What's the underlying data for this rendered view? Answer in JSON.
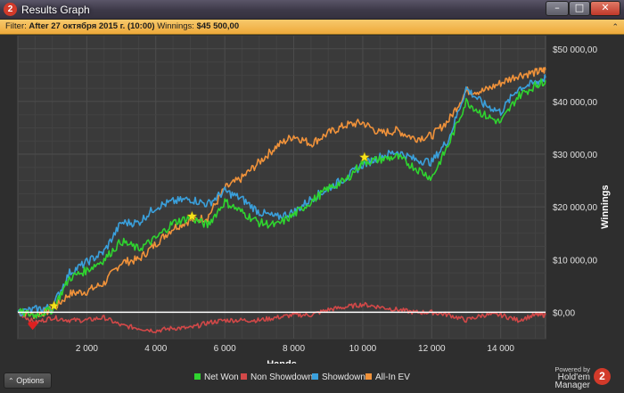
{
  "window": {
    "title": "Results Graph",
    "app_icon_glyph": "2",
    "minimize_glyph": "–",
    "maximize_glyph": "□",
    "close_glyph": "✕"
  },
  "filter": {
    "prefix": "Filter:",
    "text": "After 27 октября 2015 г. (10:00)",
    "winnings_label": "Winnings:",
    "winnings_value": "$45 500,00"
  },
  "chart_data": {
    "type": "line",
    "xlabel": "Hands",
    "ylabel": "Winnings",
    "xlim": [
      0,
      15300
    ],
    "ylim": [
      -5000,
      52500
    ],
    "x_ticks": [
      2000,
      4000,
      6000,
      8000,
      10000,
      12000,
      14000
    ],
    "x_tick_labels": [
      "2 000",
      "4 000",
      "6 000",
      "8 000",
      "10 000",
      "12 000",
      "14 000"
    ],
    "y_ticks": [
      0,
      10000,
      20000,
      30000,
      40000,
      50000
    ],
    "y_tick_labels": [
      "$0,00",
      "$10 000,00",
      "$20 000,00",
      "$30 000,00",
      "$40 000,00",
      "$50 000,00"
    ],
    "grid": true,
    "x": [
      0,
      500,
      1000,
      1500,
      2000,
      2500,
      3000,
      3500,
      4000,
      4500,
      5000,
      5500,
      6000,
      6500,
      7000,
      7500,
      8000,
      8500,
      9000,
      9500,
      10000,
      10500,
      11000,
      11500,
      12000,
      12500,
      13000,
      13500,
      14000,
      14500,
      15000,
      15300
    ],
    "series": [
      {
        "name": "Net Won",
        "color": "#2fd42f",
        "values": [
          0,
          -500,
          500,
          6500,
          8000,
          10000,
          13500,
          12000,
          14000,
          17000,
          18000,
          16500,
          21000,
          19000,
          17000,
          16500,
          18500,
          21000,
          23500,
          25000,
          28500,
          29000,
          29500,
          27500,
          25500,
          32000,
          40000,
          37500,
          36000,
          41000,
          43000,
          44000
        ]
      },
      {
        "name": "Non Showdown",
        "color": "#d24848",
        "values": [
          0,
          -2000,
          -1000,
          -1500,
          -1500,
          -1000,
          -2500,
          -3000,
          -3500,
          -3000,
          -3000,
          -2000,
          -1500,
          -1500,
          -1500,
          -1000,
          -500,
          -500,
          500,
          1000,
          1500,
          1000,
          500,
          0,
          0,
          -500,
          -1500,
          -500,
          -500,
          -1500,
          -500,
          -500
        ]
      },
      {
        "name": "Showdown",
        "color": "#3aa0dc",
        "values": [
          0,
          500,
          1000,
          7500,
          9500,
          11500,
          17000,
          17000,
          20000,
          21000,
          21500,
          20500,
          23000,
          21500,
          19000,
          18000,
          19000,
          21500,
          23500,
          25500,
          28000,
          29500,
          30500,
          29000,
          28500,
          33000,
          42500,
          39500,
          38000,
          42500,
          43500,
          44500
        ]
      },
      {
        "name": "All-In EV",
        "color": "#f0923a",
        "values": [
          0,
          -500,
          500,
          3500,
          4000,
          5500,
          9500,
          10000,
          13000,
          16000,
          17500,
          18000,
          23500,
          25500,
          28500,
          31500,
          33500,
          32000,
          34000,
          35500,
          36000,
          34000,
          34500,
          33000,
          33500,
          36500,
          42000,
          42000,
          43500,
          45000,
          45500,
          46000
        ]
      }
    ],
    "markers": [
      {
        "type": "heart",
        "x": 430,
        "y": -2500,
        "color": "#e02020"
      },
      {
        "type": "star",
        "x": 1050,
        "y": 1200,
        "color": "#f5e21a"
      },
      {
        "type": "star",
        "x": 5050,
        "y": 18200,
        "color": "#f5e21a"
      },
      {
        "type": "star",
        "x": 10050,
        "y": 29400,
        "color": "#f5e21a"
      }
    ]
  },
  "legend": {
    "items": [
      {
        "label": "Net Won",
        "color": "#2fd42f"
      },
      {
        "label": "Non Showdown",
        "color": "#d24848"
      },
      {
        "label": "Showdown",
        "color": "#3aa0dc"
      },
      {
        "label": "All-In EV",
        "color": "#f0923a"
      }
    ]
  },
  "footer": {
    "options_label": "Options",
    "options_icon": "chevron-up-icon",
    "powered_by": "Powered by",
    "brand": "Hold'em Manager",
    "brand_logo_glyph": "2"
  }
}
